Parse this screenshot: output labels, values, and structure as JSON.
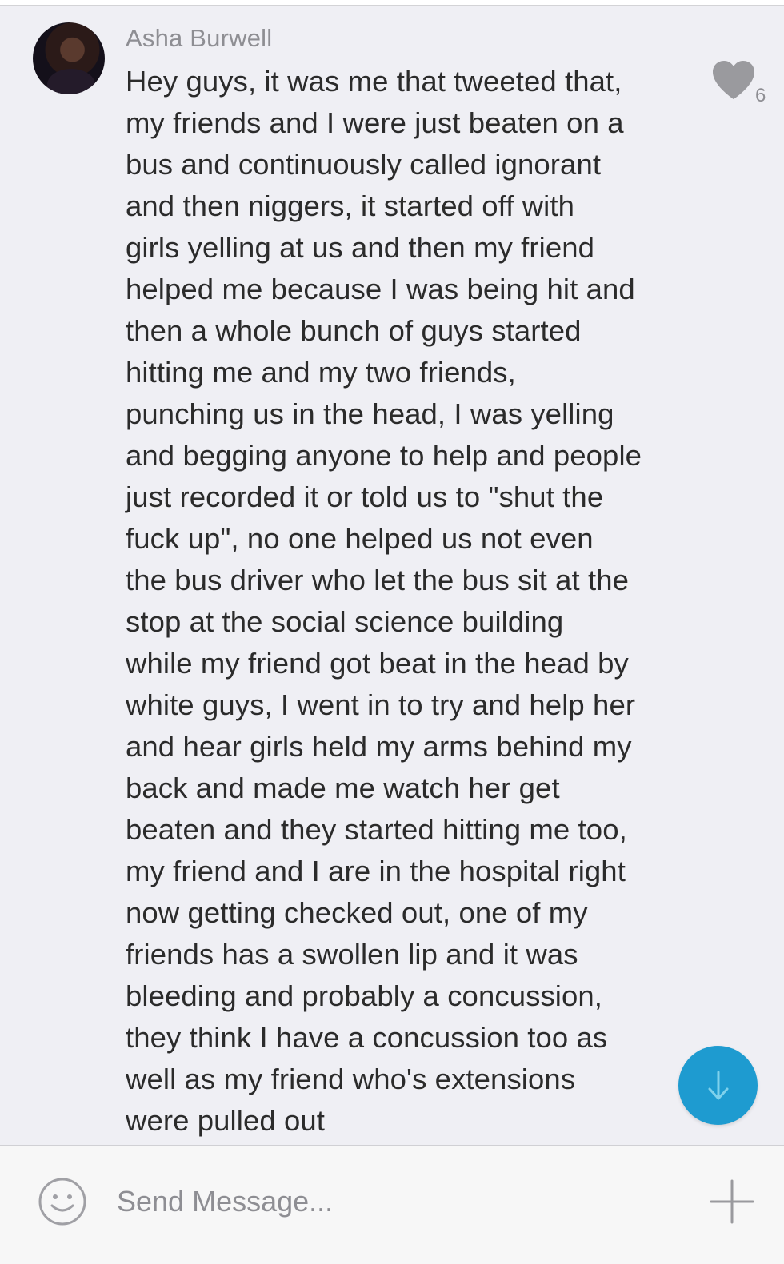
{
  "message": {
    "sender": "Asha Burwell",
    "text": "Hey guys, it was me that tweeted that,\nmy friends and I were just beaten on a\nbus and continuously called ignorant\nand then niggers, it started off with\ngirls yelling at us and then my friend\nhelped me because I was being hit and\nthen a whole bunch of guys started\nhitting me and my two friends,\npunching us in the head, I was yelling\nand begging anyone to help and people\njust recorded it or told us to \"shut the\nfuck up\", no one helped us not even\nthe bus driver who let the bus sit at the\nstop at the social science building\nwhile my friend got beat in the head by\nwhite guys, I went in to try and help her\nand hear girls held my arms behind my\nback and made me watch her get\nbeaten and they started hitting me too,\nmy friend and I are in the hospital right\nnow getting checked out, one of my\nfriends  has a swollen lip and it was\nbleeding and probably a concussion,\nthey think I have a concussion too as\nwell as my friend who's extensions\nwere pulled out",
    "like_count": "6"
  },
  "composer": {
    "placeholder": "Send Message..."
  },
  "icons": {
    "like": "heart-icon",
    "scroll": "arrow-down-icon",
    "emoji": "smiley-icon",
    "add": "plus-icon"
  },
  "colors": {
    "background": "#efeff4",
    "accent": "#1e9bd0",
    "text": "#2b2b2b",
    "muted": "#8e8e93"
  }
}
